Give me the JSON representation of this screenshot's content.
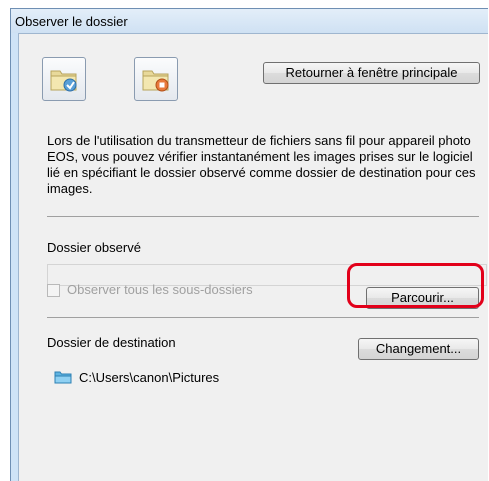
{
  "window": {
    "title": "Observer le dossier"
  },
  "toolbar": {
    "return_button": "Retourner à fenêtre principale",
    "icons": [
      "folder-watch-icon",
      "folder-stop-icon"
    ]
  },
  "description": "Lors de l'utilisation du transmetteur de fichiers sans fil pour appareil photo EOS, vous pouvez vérifier instantanément les images prises sur le logiciel lié en spécifiant le dossier observé comme dossier de destination pour ces images.",
  "observed": {
    "label": "Dossier observé",
    "path": "",
    "subfolders_label": "Observer tous les sous-dossiers",
    "subfolders_checked": false,
    "browse_button": "Parcourir..."
  },
  "destination": {
    "label": "Dossier de destination",
    "change_button": "Changement...",
    "path": "C:\\Users\\canon\\Pictures"
  },
  "colors": {
    "highlight": "#e2001a",
    "window_frame": "#cfe3f6"
  }
}
